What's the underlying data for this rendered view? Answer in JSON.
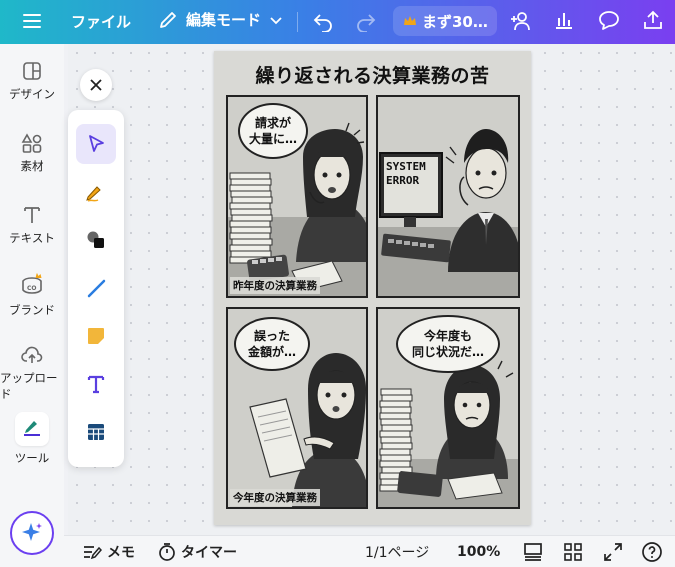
{
  "topbar": {
    "menu_icon": "hamburger-icon",
    "file_label": "ファイル",
    "edit_mode_label": "編集モード",
    "trial_label": "まず30…",
    "colors": {
      "gradient_start": "#1fb8c9",
      "gradient_mid": "#3a7fe6",
      "gradient_end": "#7a3ff0",
      "crown": "#f2a516"
    }
  },
  "sidebar": {
    "items": [
      {
        "label": "デザイン",
        "icon": "design-icon"
      },
      {
        "label": "素材",
        "icon": "elements-icon"
      },
      {
        "label": "テキスト",
        "icon": "text-icon"
      },
      {
        "label": "ブランド",
        "icon": "brand-icon"
      },
      {
        "label": "アップロード",
        "icon": "upload-icon"
      },
      {
        "label": "ツール",
        "icon": "tools-icon"
      }
    ],
    "magic_icon": "sparkle-icon"
  },
  "tools": [
    {
      "name": "select-tool",
      "icon": "pointer-icon"
    },
    {
      "name": "pen-tool",
      "icon": "pencil-icon"
    },
    {
      "name": "shape-tool",
      "icon": "shapes-icon"
    },
    {
      "name": "line-tool",
      "icon": "line-icon"
    },
    {
      "name": "sticky-tool",
      "icon": "sticky-note-icon"
    },
    {
      "name": "text-tool",
      "icon": "text-t-icon"
    },
    {
      "name": "table-tool",
      "icon": "table-icon"
    }
  ],
  "design": {
    "title": "繰り返される決算業務の苦",
    "panels": [
      {
        "bubble": "請求が\n大量に…",
        "caption": "昨年度の決算業務"
      },
      {
        "screen": "SYSTEM\nERROR"
      },
      {
        "bubble": "誤った\n金額が…",
        "caption": "今年度の決算業務"
      },
      {
        "bubble": "今年度も\n同じ状況だ…"
      }
    ]
  },
  "bottombar": {
    "memo_label": "メモ",
    "timer_label": "タイマー",
    "page_indicator": "1/1ページ",
    "zoom": "100%"
  }
}
